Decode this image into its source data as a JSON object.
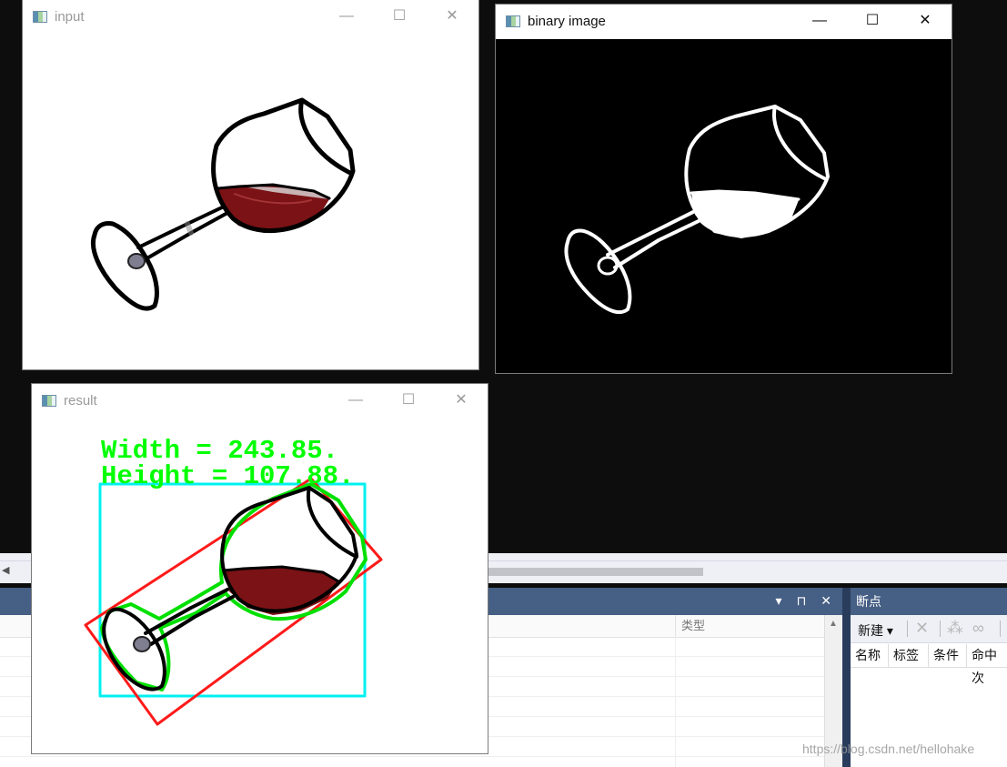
{
  "windows": {
    "input": {
      "title": "input"
    },
    "binary": {
      "title": "binary image"
    },
    "result": {
      "title": "result",
      "width_text": "Width = 243.85.",
      "height_text": "Height = 107.88."
    }
  },
  "window_controls": {
    "minimize": "—",
    "maximize": "☐",
    "close": "✕"
  },
  "ide": {
    "panel_controls": "▾ ⊓ ✕",
    "grid_col_type": "类型",
    "breakpoints": {
      "title": "断点",
      "new_label": "新建 ▾",
      "columns": [
        "名称",
        "标签",
        "条件",
        "命中次"
      ]
    }
  },
  "watermark": "https://blog.csdn.net/hellohake",
  "colors": {
    "min_rect": "#ff1a1a",
    "bound_rect": "#00f0f0",
    "contour": "#00e000",
    "text": "#00ff00",
    "wine": "#7a1216"
  }
}
